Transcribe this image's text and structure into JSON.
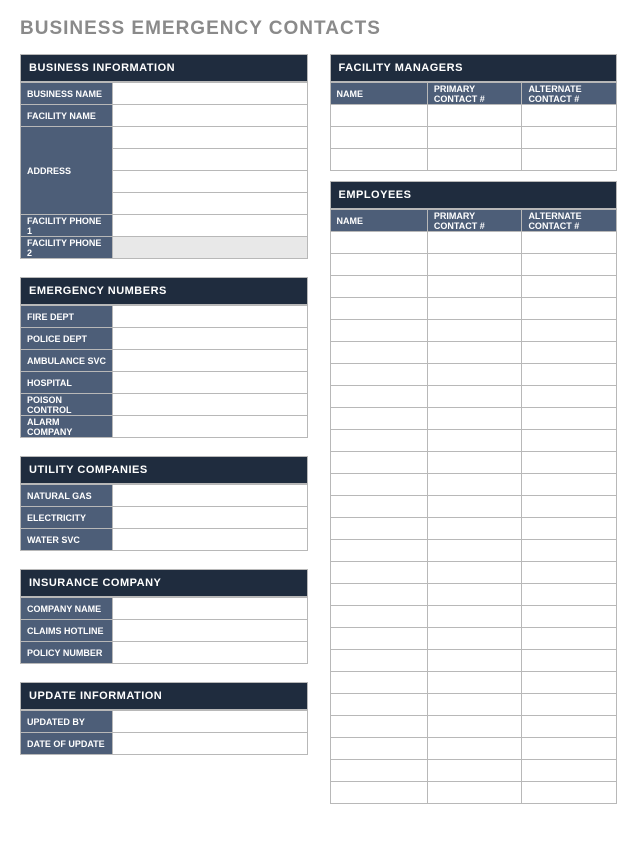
{
  "title": "BUSINESS EMERGENCY CONTACTS",
  "businessInfo": {
    "header": "BUSINESS INFORMATION",
    "fields": {
      "businessName": {
        "label": "BUSINESS NAME",
        "value": ""
      },
      "facilityName": {
        "label": "FACILITY NAME",
        "value": ""
      },
      "address": {
        "label": "ADDRESS",
        "values": [
          "",
          "",
          "",
          ""
        ]
      },
      "phone1": {
        "label": "FACILITY PHONE 1",
        "value": ""
      },
      "phone2": {
        "label": "FACILITY PHONE 2",
        "value": ""
      }
    }
  },
  "emergencyNumbers": {
    "header": "EMERGENCY NUMBERS",
    "rows": [
      {
        "label": "FIRE DEPT",
        "value": ""
      },
      {
        "label": "POLICE DEPT",
        "value": ""
      },
      {
        "label": "AMBULANCE SVC",
        "value": ""
      },
      {
        "label": "HOSPITAL",
        "value": ""
      },
      {
        "label": "POISON CONTROL",
        "value": ""
      },
      {
        "label": "ALARM COMPANY",
        "value": ""
      }
    ]
  },
  "utilityCompanies": {
    "header": "UTILITY COMPANIES",
    "rows": [
      {
        "label": "NATURAL GAS",
        "value": ""
      },
      {
        "label": "ELECTRICITY",
        "value": ""
      },
      {
        "label": "WATER SVC",
        "value": ""
      }
    ]
  },
  "insuranceCompany": {
    "header": "INSURANCE COMPANY",
    "rows": [
      {
        "label": "COMPANY NAME",
        "value": ""
      },
      {
        "label": "CLAIMS HOTLINE",
        "value": ""
      },
      {
        "label": "POLICY NUMBER",
        "value": ""
      }
    ]
  },
  "updateInfo": {
    "header": "UPDATE INFORMATION",
    "rows": [
      {
        "label": "UPDATED BY",
        "value": ""
      },
      {
        "label": "DATE OF UPDATE",
        "value": ""
      }
    ]
  },
  "facilityManagers": {
    "header": "FACILITY MANAGERS",
    "columns": [
      "NAME",
      "PRIMARY CONTACT #",
      "ALTERNATE CONTACT #"
    ],
    "rows": [
      {
        "name": "",
        "primary": "",
        "alternate": ""
      },
      {
        "name": "",
        "primary": "",
        "alternate": ""
      },
      {
        "name": "",
        "primary": "",
        "alternate": ""
      }
    ]
  },
  "employees": {
    "header": "EMPLOYEES",
    "columns": [
      "NAME",
      "PRIMARY CONTACT #",
      "ALTERNATE CONTACT #"
    ],
    "rowCount": 26,
    "rows": []
  }
}
